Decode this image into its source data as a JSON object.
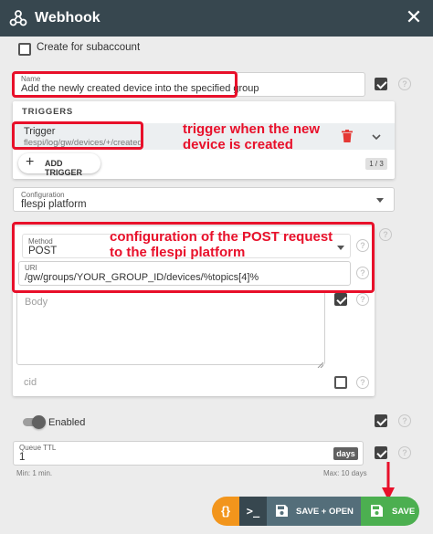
{
  "header": {
    "title": "Webhook",
    "close_label": "✕"
  },
  "subaccount": {
    "label": "Create for subaccount"
  },
  "name_field": {
    "label": "Name",
    "value": "Add the newly created device into the specified group"
  },
  "triggers": {
    "heading": "TRIGGERS",
    "item_title": "Trigger",
    "item_value": "flespi/log/gw/devices/+/created",
    "add_label": "ADD TRIGGER",
    "pager": "1 / 3"
  },
  "annotations": {
    "trigger_note_line1": "trigger when the new",
    "trigger_note_line2": "device is created",
    "config_note_line1": "configuration of the POST request",
    "config_note_line2": "to the flespi platform"
  },
  "configuration": {
    "label": "Configuration",
    "value": "flespi platform"
  },
  "method": {
    "label": "Method",
    "value": "POST"
  },
  "uri": {
    "label": "URI",
    "value": "/gw/groups/YOUR_GROUP_ID/devices/%topics[4]%"
  },
  "body": {
    "placeholder": "Body"
  },
  "cid": {
    "label": "cid"
  },
  "enabled": {
    "label": "Enabled"
  },
  "queue_ttl": {
    "label": "Queue TTL",
    "value": "1",
    "unit": "days",
    "min_hint": "Min: 1 min.",
    "max_hint": "Max: 10 days"
  },
  "actions": {
    "code_label": "{}",
    "terminal_label": ">_",
    "save_open_label": "SAVE + OPEN",
    "save_label": "SAVE"
  },
  "colors": {
    "header": "#37474f",
    "accent_red": "#e8102a",
    "orange": "#f2951c",
    "save_green": "#4caf50",
    "dark_button": "#546e7a"
  }
}
